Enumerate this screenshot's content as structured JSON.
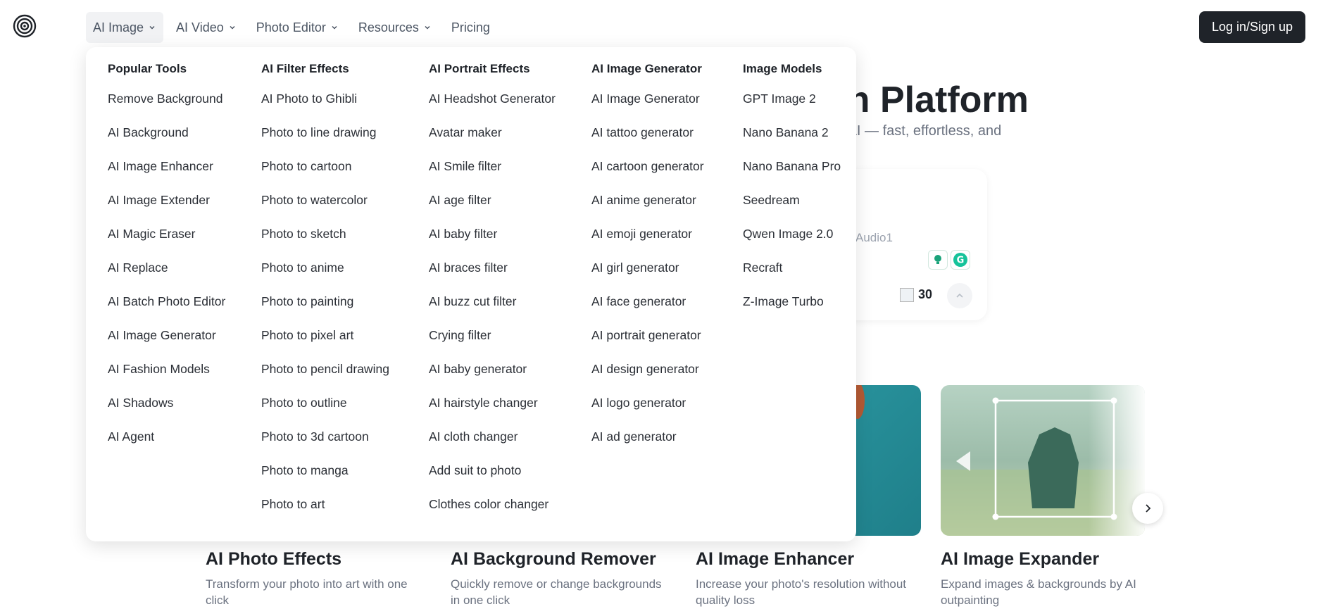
{
  "header": {
    "nav": [
      {
        "label": "AI Image",
        "has_chevron": true,
        "active": true
      },
      {
        "label": "AI Video",
        "has_chevron": true,
        "active": false
      },
      {
        "label": "Photo Editor",
        "has_chevron": true,
        "active": false
      },
      {
        "label": "Resources",
        "has_chevron": true,
        "active": false
      },
      {
        "label": "Pricing",
        "has_chevron": false,
        "active": false
      }
    ],
    "login_label": "Log in/Sign up"
  },
  "hero": {
    "title_partial": "on Platform",
    "subtitle_partial": "h AI — fast, effortless, and",
    "prompt_card": {
      "audio_text": "Audio1",
      "credits": "30"
    }
  },
  "features": [
    {
      "title": "AI Photo Effects",
      "desc": "Transform your photo into art with one click"
    },
    {
      "title": "AI Background Remover",
      "desc": "Quickly remove or change backgrounds in one click"
    },
    {
      "title": "AI Image Enhancer",
      "desc": "Increase your photo's resolution without quality loss"
    },
    {
      "title": "AI Image Expander",
      "desc": "Expand images & backgrounds by AI outpainting"
    }
  ],
  "menu": {
    "columns": [
      {
        "title": "Popular Tools",
        "items": [
          "Remove Background",
          "AI Background",
          "AI Image Enhancer",
          "AI Image Extender",
          "AI Magic Eraser",
          "AI Replace",
          "AI Batch Photo Editor",
          "AI Image Generator",
          "AI Fashion Models",
          "AI Shadows",
          "AI Agent"
        ]
      },
      {
        "title": "AI Filter Effects",
        "items": [
          "AI Photo to Ghibli",
          "Photo to line drawing",
          "Photo to cartoon",
          "Photo to watercolor",
          "Photo to sketch",
          "Photo to anime",
          "Photo to painting",
          "Photo to pixel art",
          "Photo to pencil drawing",
          "Photo to outline",
          "Photo to 3d cartoon",
          "Photo to manga",
          "Photo to art"
        ]
      },
      {
        "title": "AI Portrait Effects",
        "items": [
          "AI Headshot Generator",
          "Avatar maker",
          "AI Smile filter",
          "AI age filter",
          "AI baby filter",
          "AI braces filter",
          "AI buzz cut filter",
          "Crying filter",
          "AI baby generator",
          "AI hairstyle changer",
          "AI cloth changer",
          "Add suit to photo",
          "Clothes color changer"
        ]
      },
      {
        "title": "AI Image Generator",
        "items": [
          "AI Image Generator",
          "AI tattoo generator",
          "AI cartoon generator",
          "AI anime generator",
          "AI emoji generator",
          "AI girl generator",
          "AI face generator",
          "AI portrait generator",
          "AI design generator",
          "AI logo generator",
          "AI ad generator"
        ]
      },
      {
        "title": "Image Models",
        "items": [
          "GPT Image 2",
          "Nano Banana 2",
          "Nano Banana Pro",
          "Seedream",
          "Qwen Image 2.0",
          "Recraft",
          "Z-Image Turbo"
        ]
      }
    ]
  },
  "colors": {
    "primary_dark": "#1f2329",
    "muted_text": "#6b7280",
    "nav_active_bg": "#f1f2f4",
    "teal": "#2e9ea7"
  },
  "icons": {
    "logo": "spiral-logo-icon",
    "chevron": "chevron-down-icon",
    "next": "chevron-right-icon"
  }
}
